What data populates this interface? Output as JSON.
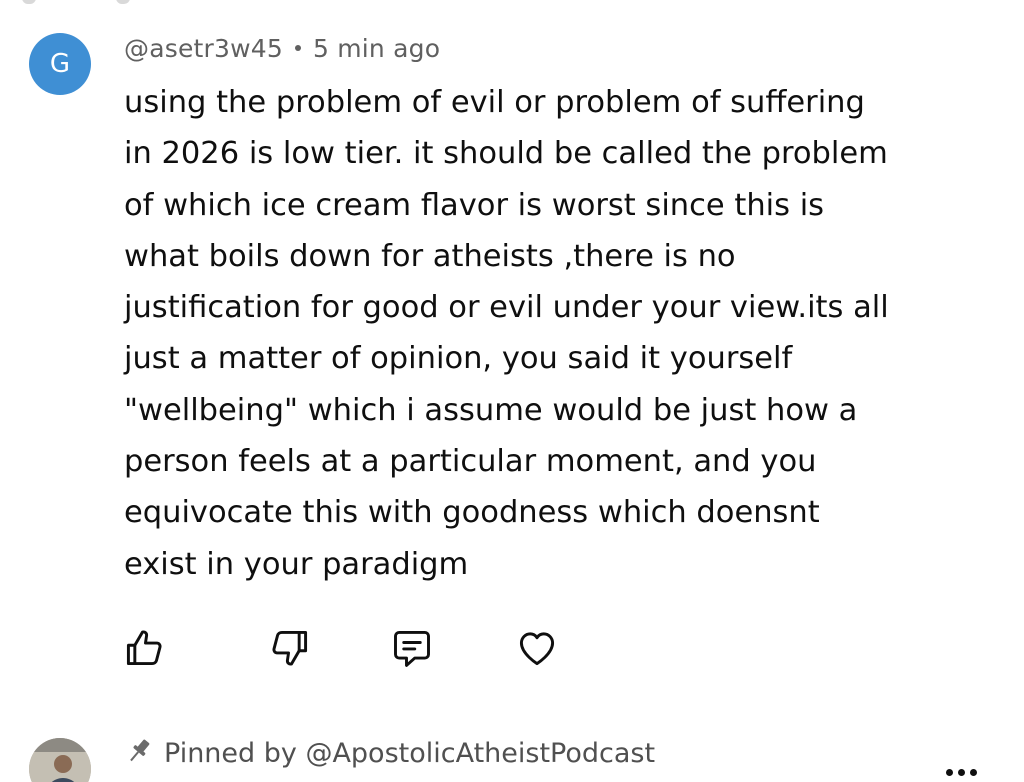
{
  "comment": {
    "avatar_letter": "G",
    "avatar_color": "#3f8fd4",
    "username": "@asetr3w45",
    "separator": "•",
    "timestamp": "5 min ago",
    "text": "using the problem of evil or problem of suffering\nin 2026 is low tier. it should be called the problem\nof which ice cream flavor is worst since this is\nwhat boils down for atheists ,there is no\njustification for good or evil under your view.its all\njust a matter of opinion, you said it yourself\n\"wellbeing\" which i assume would be just how a\nperson feels at a particular moment, and you\nequivocate this with goodness which doensnt\nexist in your paradigm",
    "actions": [
      {
        "icon": "thumbs-up-icon"
      },
      {
        "icon": "thumbs-down-icon"
      },
      {
        "icon": "reply-icon"
      },
      {
        "icon": "heart-icon"
      }
    ]
  },
  "pinned": {
    "icon": "pin-icon",
    "label": "Pinned by @ApostolicAtheistPodcast",
    "menu_icon": "more-options-icon"
  }
}
